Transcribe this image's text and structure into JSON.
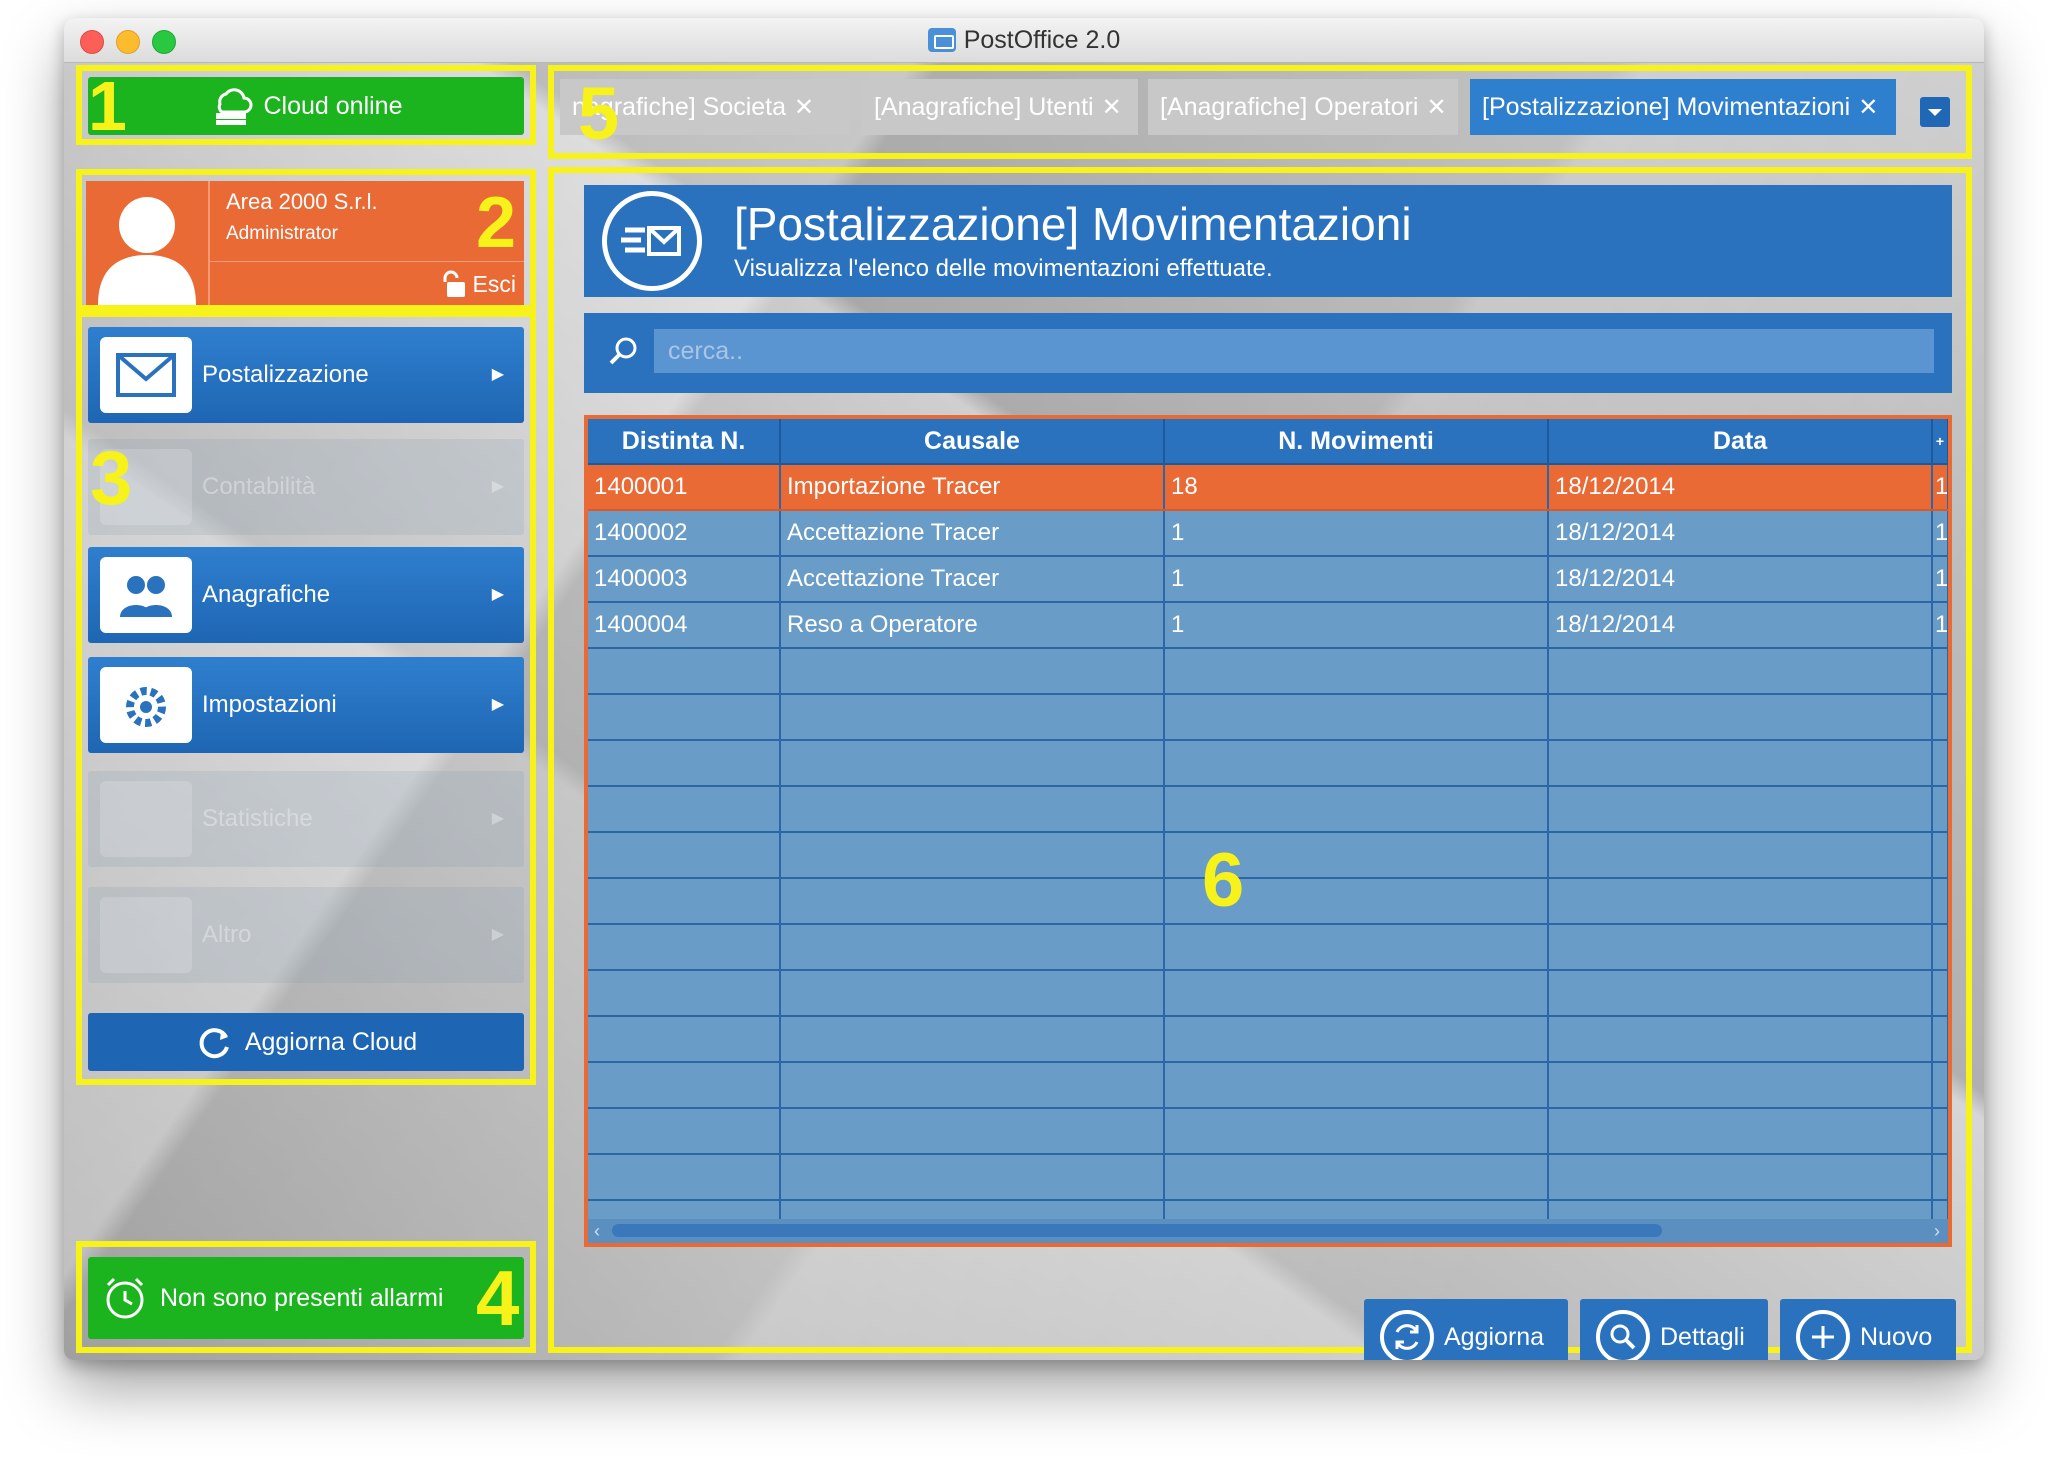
{
  "window": {
    "title": "PostOffice 2.0"
  },
  "sidebar": {
    "cloud_status": "Cloud online",
    "user": {
      "company": "Area 2000 S.r.l.",
      "role": "Administrator",
      "logout": "Esci"
    },
    "menu": [
      {
        "label": "Postalizzazione",
        "enabled": true,
        "icon": "envelopes-icon"
      },
      {
        "label": "Contabilità",
        "enabled": false,
        "icon": "calculator-icon"
      },
      {
        "label": "Anagrafiche",
        "enabled": true,
        "icon": "users-icon"
      },
      {
        "label": "Impostazioni",
        "enabled": true,
        "icon": "gear-icon"
      },
      {
        "label": "Statistiche",
        "enabled": false,
        "icon": "bar-chart-icon"
      },
      {
        "label": "Altro",
        "enabled": false,
        "icon": "puzzle-icon"
      }
    ],
    "refresh_cloud": "Aggiorna Cloud",
    "alarms": "Non sono presenti allarmi"
  },
  "tabs": [
    {
      "label": "nagrafiche] Societa",
      "active": false
    },
    {
      "label": "[Anagrafiche] Utenti",
      "active": false
    },
    {
      "label": "[Anagrafiche] Operatori",
      "active": false
    },
    {
      "label": "[Postalizzazione] Movimentazioni",
      "active": true
    }
  ],
  "page": {
    "title": "[Postalizzazione] Movimentazioni",
    "subtitle": "Visualizza l'elenco delle movimentazioni effettuate."
  },
  "search": {
    "placeholder": "cerca..",
    "value": ""
  },
  "table": {
    "columns": [
      "Distinta N.",
      "Causale",
      "N. Movimenti",
      "Data"
    ],
    "rows": [
      {
        "distinta": "1400001",
        "causale": "Importazione Tracer",
        "movimenti": "18",
        "data": "18/12/2014",
        "extra": "1"
      },
      {
        "distinta": "1400002",
        "causale": "Accettazione Tracer",
        "movimenti": "1",
        "data": "18/12/2014",
        "extra": "1"
      },
      {
        "distinta": "1400003",
        "causale": "Accettazione Tracer",
        "movimenti": "1",
        "data": "18/12/2014",
        "extra": "1"
      },
      {
        "distinta": "1400004",
        "causale": "Reso a Operatore",
        "movimenti": "1",
        "data": "18/12/2014",
        "extra": "1"
      }
    ],
    "selected_row": 0
  },
  "actions": {
    "refresh": "Aggiorna",
    "details": "Dettagli",
    "new": "Nuovo"
  },
  "annotations": [
    "1",
    "2",
    "3",
    "4",
    "5",
    "6"
  ],
  "colors": {
    "accent_blue": "#2a72be",
    "orange": "#ea6a35",
    "green": "#1bb31e",
    "highlight_yellow": "#f6f21a"
  }
}
